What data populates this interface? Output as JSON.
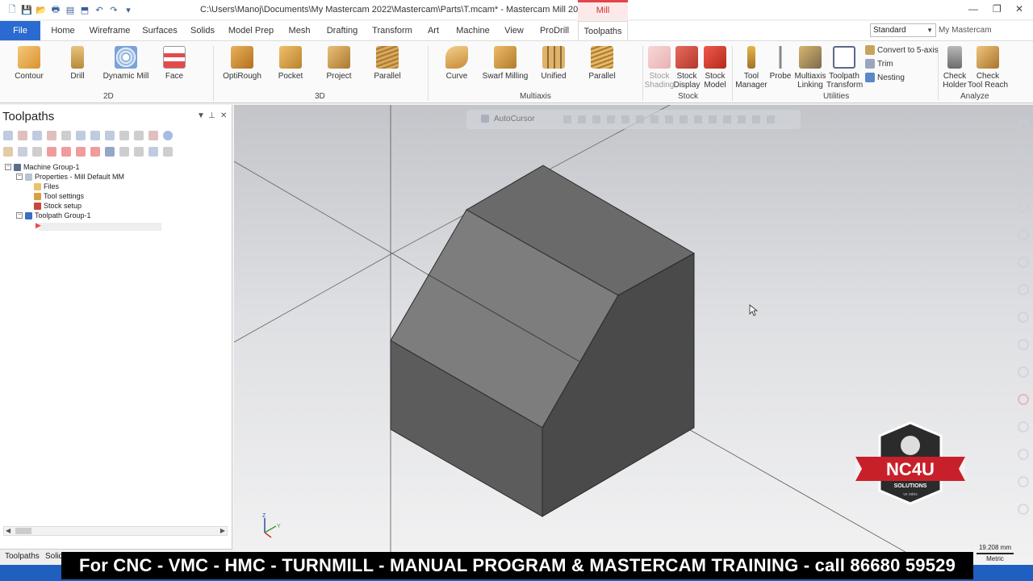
{
  "window": {
    "title": "C:\\Users\\Manoj\\Documents\\My Mastercam 2022\\Mastercam\\Parts\\T.mcam* - Mastercam Mill 2022",
    "context_tab": "Mill",
    "minimize": "—",
    "restore": "❐",
    "close": "✕"
  },
  "tabs": [
    "File",
    "Home",
    "Wireframe",
    "Surfaces",
    "Solids",
    "Model Prep",
    "Mesh",
    "Drafting",
    "Transform",
    "Art",
    "Machine",
    "View",
    "ProDrill",
    "Toolpaths"
  ],
  "active_tab": "Toolpaths",
  "workspace": {
    "value": "Standard",
    "my_mastercam": "My Mastercam"
  },
  "ribbon": {
    "group_2d": {
      "label": "2D",
      "buttons": [
        "Contour",
        "Drill",
        "Dynamic Mill",
        "Face"
      ]
    },
    "group_3d": {
      "label": "3D",
      "buttons": [
        "OptiRough",
        "Pocket",
        "Project",
        "Parallel"
      ]
    },
    "group_multiaxis": {
      "label": "Multiaxis",
      "buttons": [
        "Curve",
        "Swarf Milling",
        "Unified",
        "Parallel"
      ]
    },
    "group_stock": {
      "label": "Stock",
      "buttons": [
        [
          "Stock",
          "Shading"
        ],
        [
          "Stock",
          "Display"
        ],
        [
          "Stock",
          "Model"
        ]
      ]
    },
    "group_utilities": {
      "label": "Utilities",
      "buttons": [
        [
          "Tool",
          "Manager"
        ],
        [
          "Probe",
          ""
        ],
        [
          "Multiaxis",
          "Linking"
        ],
        [
          "Toolpath",
          "Transform"
        ]
      ],
      "small": [
        "Convert to 5-axis",
        "Trim",
        "Nesting"
      ]
    },
    "group_analyze": {
      "label": "Analyze",
      "buttons": [
        [
          "Check",
          "Holder"
        ],
        [
          "Check",
          "Tool Reach"
        ]
      ]
    }
  },
  "panel": {
    "title": "Toolpaths",
    "tree": [
      "Machine Group-1",
      "Properties - Mill Default MM",
      "Files",
      "Tool settings",
      "Stock setup",
      "Toolpath Group-1"
    ],
    "bottom_tabs": [
      "Toolpaths",
      "Solids"
    ]
  },
  "viewport": {
    "autocursor": "AutoCursor",
    "scale_value": "19.208 mm",
    "scale_unit": "Metric"
  },
  "logo": {
    "brand": "NC4U",
    "sub": "SOLUTIONS",
    "tagline": "ve odes"
  },
  "banner": "For CNC - VMC - HMC - TURNMILL - MANUAL PROGRAM & MASTERCAM TRAINING - call 86680 59529",
  "colors": {
    "file_tab": "#2b6ad0",
    "accent_red": "#e3454b",
    "solid_gray": "#5b5b5b",
    "banner_bg": "#000000"
  }
}
